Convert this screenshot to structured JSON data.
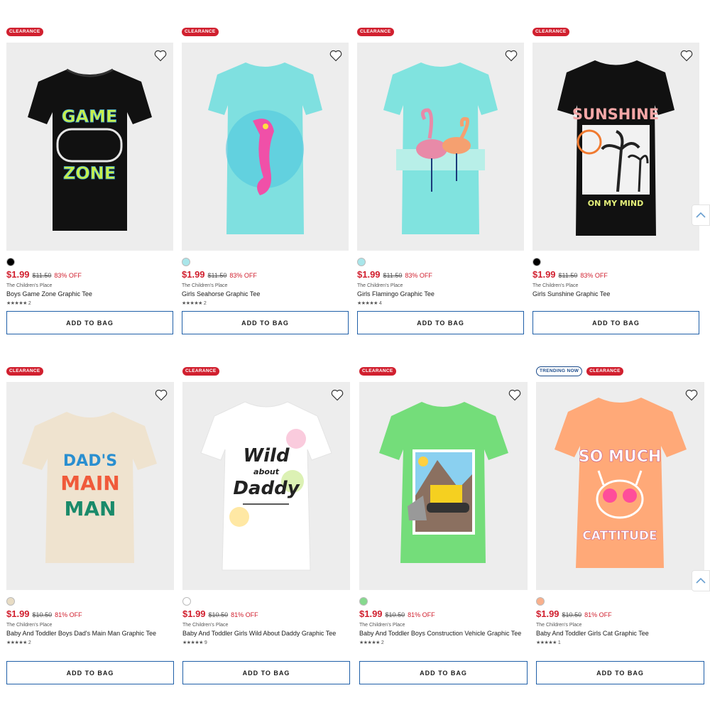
{
  "products": [
    {
      "badges": [
        "CLEARANCE"
      ],
      "price": "$1.99",
      "was": "$11.50",
      "off": "83% OFF",
      "brand": "The Children's Place",
      "name": "Boys Game Zone Graphic Tee",
      "stars": "★★★★★",
      "reviews": "2",
      "button": "ADD TO BAG",
      "swatch": "#000000",
      "shirt": "#111111",
      "graphic": [
        "GAME",
        "ZONE"
      ]
    },
    {
      "badges": [
        "CLEARANCE"
      ],
      "price": "$1.99",
      "was": "$11.50",
      "off": "83% OFF",
      "brand": "The Children's Place",
      "name": "Girls Seahorse Graphic Tee",
      "stars": "★★★★★",
      "reviews": "2",
      "button": "ADD TO BAG",
      "swatch": "#a9e6ea",
      "shirt": "#7fe0e0",
      "graphic": []
    },
    {
      "badges": [
        "CLEARANCE"
      ],
      "price": "$1.99",
      "was": "$11.50",
      "off": "83% OFF",
      "brand": "The Children's Place",
      "name": "Girls Flamingo Graphic Tee",
      "stars": "★★★★★",
      "reviews": "4",
      "button": "ADD TO BAG",
      "swatch": "#a9e6ea",
      "shirt": "#80e3df",
      "graphic": []
    },
    {
      "badges": [
        "CLEARANCE"
      ],
      "price": "$1.99",
      "was": "$11.50",
      "off": "83% OFF",
      "brand": "The Children's Place",
      "name": "Girls Sunshine Graphic Tee",
      "stars": "★★★★★",
      "reviews": "",
      "button": "ADD TO BAG",
      "swatch": "#000000",
      "shirt": "#111111",
      "graphic": [
        "SUNSHINE",
        "ON MY MIND"
      ]
    },
    {
      "badges": [
        "CLEARANCE"
      ],
      "price": "$1.99",
      "was": "$10.50",
      "off": "81% OFF",
      "brand": "The Children's Place",
      "name": "Baby And Toddler Boys Dad's Main Man Graphic Tee",
      "stars": "★★★★★",
      "reviews": "2",
      "button": "ADD TO BAG",
      "swatch": "#e8dcc4",
      "shirt": "#efe3cf",
      "graphic": [
        "DAD'S",
        "MAIN",
        "MAN"
      ]
    },
    {
      "badges": [
        "CLEARANCE"
      ],
      "price": "$1.99",
      "was": "$10.50",
      "off": "81% OFF",
      "brand": "The Children's Place",
      "name": "Baby And Toddler Girls Wild About Daddy Graphic Tee",
      "stars": "★★★★★",
      "reviews": "9",
      "button": "ADD TO BAG",
      "swatch": "#ffffff",
      "shirt": "#ffffff",
      "graphic": [
        "Wild",
        "about",
        "Daddy"
      ]
    },
    {
      "badges": [
        "CLEARANCE"
      ],
      "price": "$1.99",
      "was": "$10.50",
      "off": "81% OFF",
      "brand": "The Children's Place",
      "name": "Baby And Toddler Boys Construction Vehicle Graphic Tee",
      "stars": "★★★★★",
      "reviews": "2",
      "button": "ADD TO BAG",
      "swatch": "#86d98e",
      "shirt": "#74dd7a",
      "graphic": []
    },
    {
      "badges": [
        "TRENDING NOW",
        "CLEARANCE"
      ],
      "price": "$1.99",
      "was": "$10.50",
      "off": "81% OFF",
      "brand": "The Children's Place",
      "name": "Baby And Toddler Girls Cat Graphic Tee",
      "stars": "★★★★★",
      "reviews": "1",
      "button": "ADD TO BAG",
      "swatch": "#f9b08c",
      "shirt": "#ffa978",
      "graphic": [
        "SO MUCH",
        "CATTITUDE"
      ]
    }
  ],
  "colors": {
    "clearance": "#d1202f",
    "price": "#d1202f",
    "button_border": "#1f5fa8",
    "image_bg": "#ededed"
  },
  "icons": {
    "favorite": "heart-icon",
    "scroll": "chevron-up-icon"
  }
}
